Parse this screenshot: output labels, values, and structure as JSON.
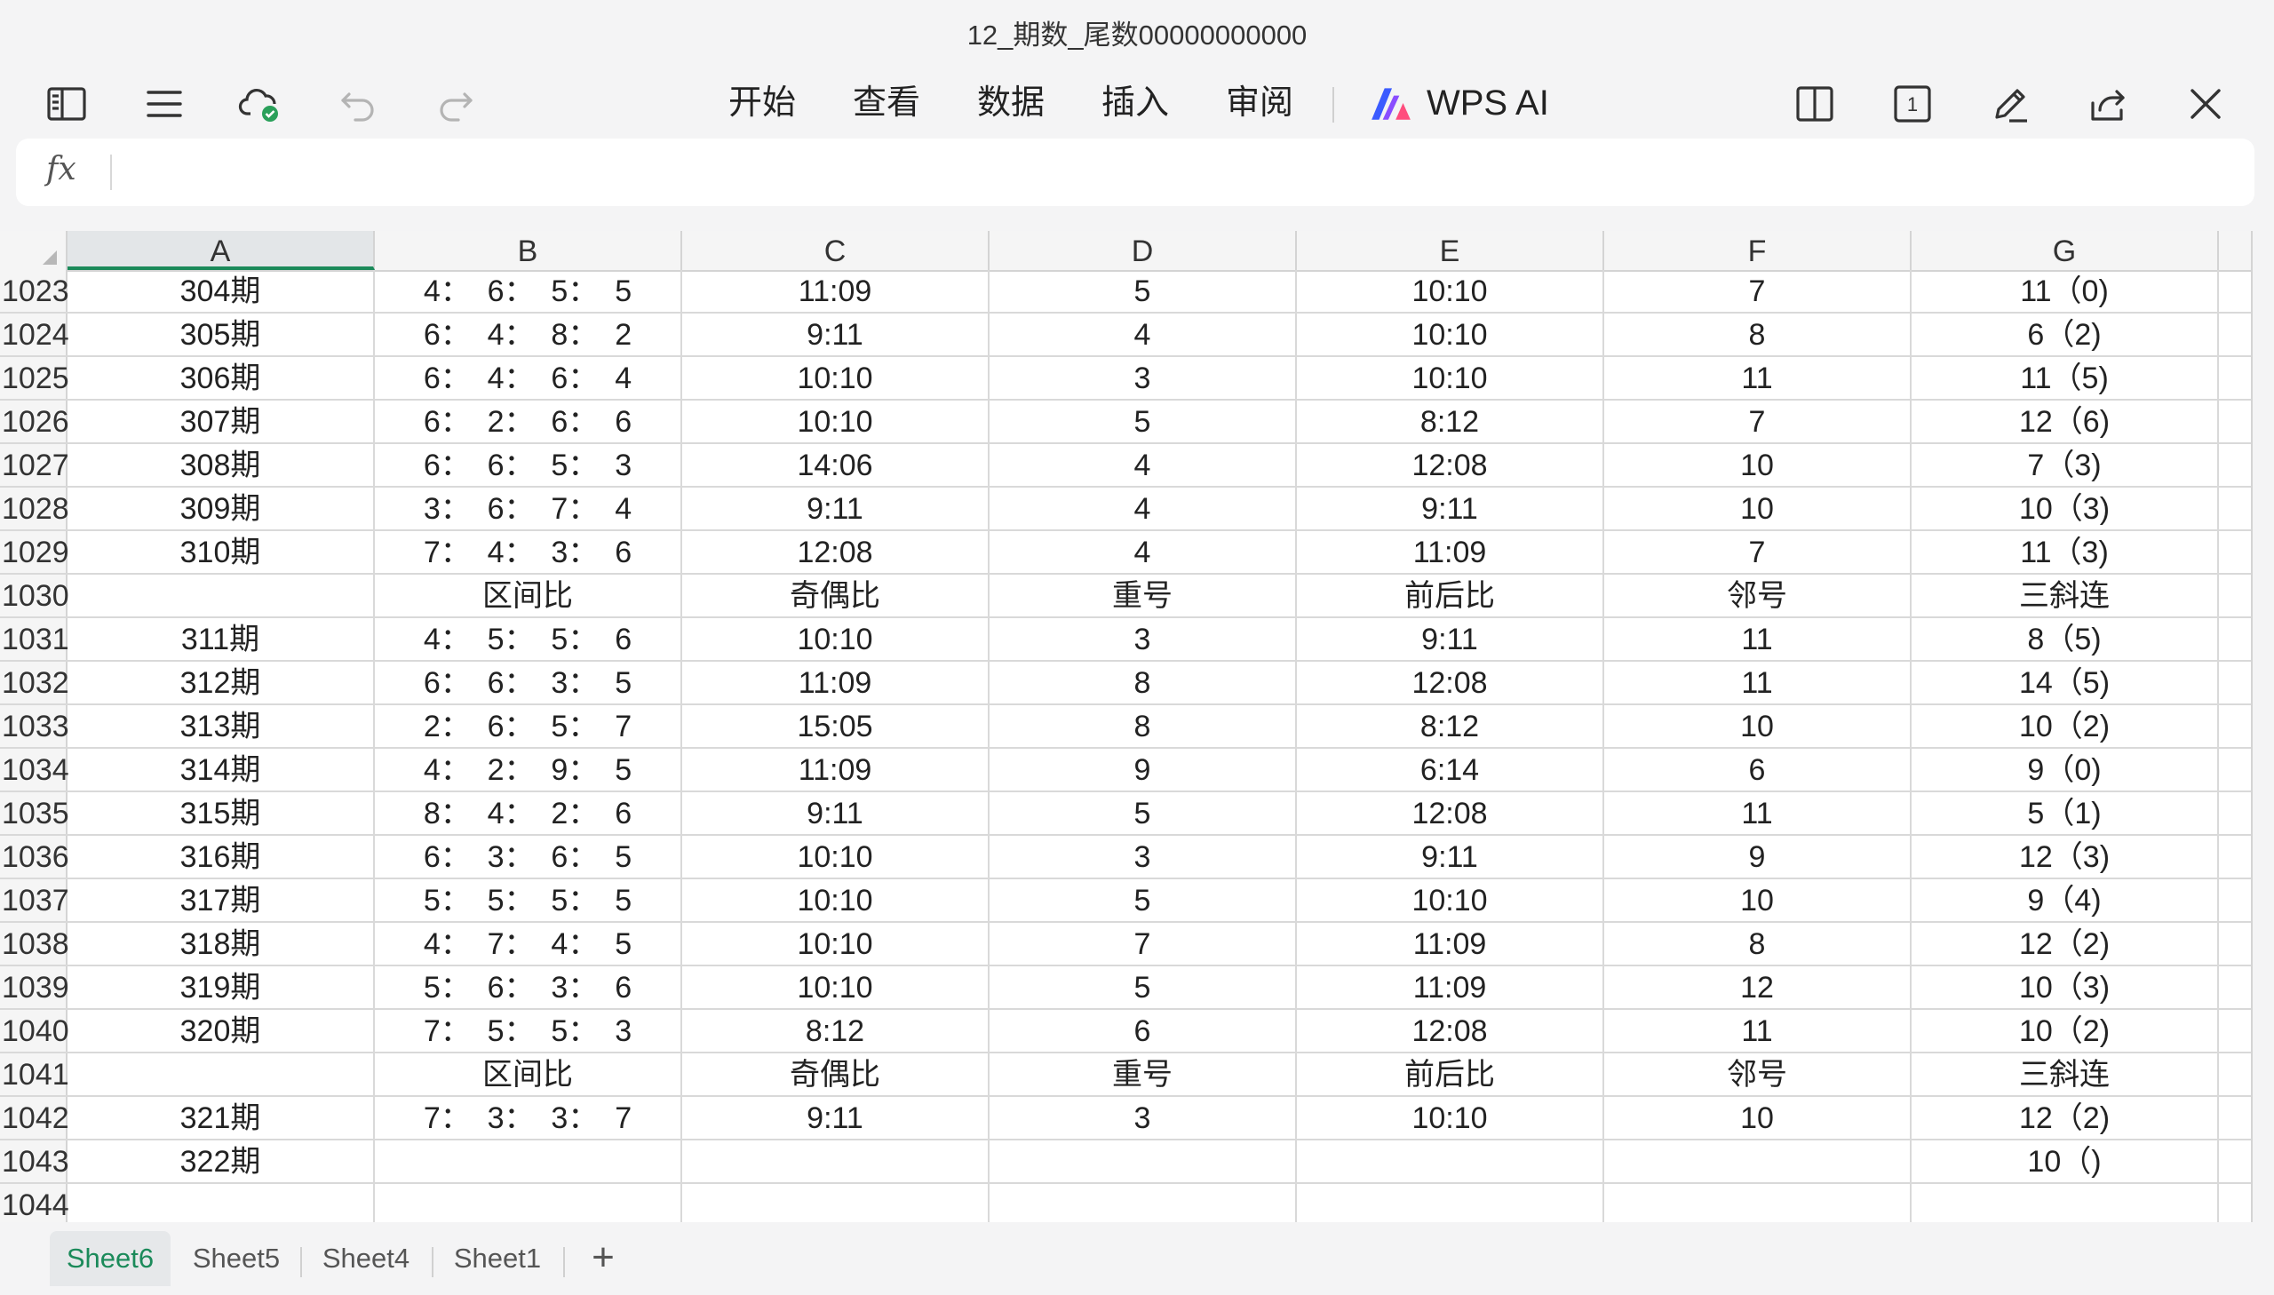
{
  "window": {
    "title": "12_期数_尾数00000000000"
  },
  "toolbar": {
    "left_icons": [
      "sidebar-panel-icon",
      "hamburger-menu-icon",
      "cloud-sync-icon",
      "undo-icon",
      "redo-icon"
    ],
    "menu": [
      "开始",
      "查看",
      "数据",
      "插入",
      "审阅"
    ],
    "wps_ai_label": "WPS AI",
    "right_icons": [
      "split-view-icon",
      "page-count-icon",
      "edit-pen-icon",
      "share-icon",
      "close-icon"
    ],
    "page_count": "1"
  },
  "formula_bar": {
    "fx": "fx",
    "value": ""
  },
  "sheet": {
    "columns": [
      "A",
      "B",
      "C",
      "D",
      "E",
      "F",
      "G"
    ],
    "active_column": "A",
    "rows": [
      {
        "n": "1023",
        "cells": [
          "304期",
          "4：  6：  5：  5",
          "11:09",
          "5",
          "10:10",
          "7",
          "11（0)"
        ]
      },
      {
        "n": "1024",
        "cells": [
          "305期",
          "6：  4：  8：  2",
          "9:11",
          "4",
          "10:10",
          "8",
          "6（2)"
        ]
      },
      {
        "n": "1025",
        "cells": [
          "306期",
          "6：  4：  6：  4",
          "10:10",
          "3",
          "10:10",
          "11",
          "11（5)"
        ]
      },
      {
        "n": "1026",
        "cells": [
          "307期",
          "6：  2：  6：  6",
          "10:10",
          "5",
          "8:12",
          "7",
          "12（6)"
        ]
      },
      {
        "n": "1027",
        "cells": [
          "308期",
          "6：  6：  5：  3",
          "14:06",
          "4",
          "12:08",
          "10",
          "7（3)"
        ]
      },
      {
        "n": "1028",
        "cells": [
          "309期",
          "3：  6：  7：  4",
          "9:11",
          "4",
          "9:11",
          "10",
          "10（3)"
        ]
      },
      {
        "n": "1029",
        "cells": [
          "310期",
          "7：  4：  3：  6",
          "12:08",
          "4",
          "11:09",
          "7",
          "11（3)"
        ]
      },
      {
        "n": "1030",
        "cells": [
          "",
          "区间比",
          "奇偶比",
          "重号",
          "前后比",
          "邻号",
          "三斜连"
        ]
      },
      {
        "n": "1031",
        "cells": [
          "311期",
          "4：  5：  5：  6",
          "10:10",
          "3",
          "9:11",
          "11",
          "8（5)"
        ]
      },
      {
        "n": "1032",
        "cells": [
          "312期",
          "6：  6：  3：  5",
          "11:09",
          "8",
          "12:08",
          "11",
          "14（5)"
        ]
      },
      {
        "n": "1033",
        "cells": [
          "313期",
          "2：  6：  5：  7",
          "15:05",
          "8",
          "8:12",
          "10",
          "10（2)"
        ]
      },
      {
        "n": "1034",
        "cells": [
          "314期",
          "4：  2：  9：  5",
          "11:09",
          "9",
          "6:14",
          "6",
          "9（0)"
        ]
      },
      {
        "n": "1035",
        "cells": [
          "315期",
          "8：  4：  2：  6",
          "9:11",
          "5",
          "12:08",
          "11",
          "5（1)"
        ]
      },
      {
        "n": "1036",
        "cells": [
          "316期",
          "6：  3：  6：  5",
          "10:10",
          "3",
          "9:11",
          "9",
          "12（3)"
        ]
      },
      {
        "n": "1037",
        "cells": [
          "317期",
          "5：  5：  5：  5",
          "10:10",
          "5",
          "10:10",
          "10",
          "9（4)"
        ]
      },
      {
        "n": "1038",
        "cells": [
          "318期",
          "4：  7：  4：  5",
          "10:10",
          "7",
          "11:09",
          "8",
          "12（2)"
        ]
      },
      {
        "n": "1039",
        "cells": [
          "319期",
          "5：  6：  3：  6",
          "10:10",
          "5",
          "11:09",
          "12",
          "10（3)"
        ]
      },
      {
        "n": "1040",
        "cells": [
          "320期",
          "7：  5：  5：  3",
          "8:12",
          "6",
          "12:08",
          "11",
          "10（2)"
        ]
      },
      {
        "n": "1041",
        "cells": [
          "",
          "区间比",
          "奇偶比",
          "重号",
          "前后比",
          "邻号",
          "三斜连"
        ]
      },
      {
        "n": "1042",
        "cells": [
          "321期",
          "7：  3：  3：  7",
          "9:11",
          "3",
          "10:10",
          "10",
          "12（2)"
        ]
      },
      {
        "n": "1043",
        "cells": [
          "322期",
          "",
          "",
          "",
          "",
          "",
          "10（)"
        ]
      },
      {
        "n": "1044",
        "cells": [
          "",
          "",
          "",
          "",
          "",
          "",
          ""
        ]
      }
    ]
  },
  "sheet_tabs": {
    "tabs": [
      "Sheet6",
      "Sheet5",
      "Sheet4",
      "Sheet1"
    ],
    "active": "Sheet6",
    "add_label": "+"
  },
  "colors": {
    "accent": "#1b8a5a",
    "grid_line": "#d9d9d9",
    "header_bg": "#f5f5f5"
  }
}
